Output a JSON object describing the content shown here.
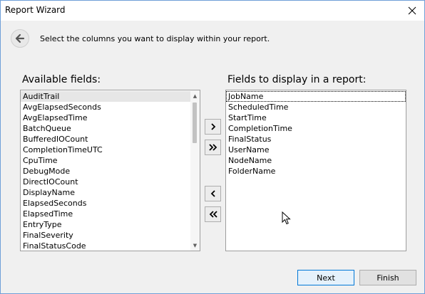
{
  "window": {
    "title": "Report Wizard",
    "close_icon": "close-icon"
  },
  "header": {
    "back_icon": "back-arrow-icon",
    "instruction": "Select the columns you want to display within your report."
  },
  "available": {
    "label": "Available fields:",
    "items": [
      "AuditTrail",
      "AvgElapsedSeconds",
      "AvgElapsedTime",
      "BatchQueue",
      "BufferedIOCount",
      "CompletionTimeUTC",
      "CpuTime",
      "DebugMode",
      "DirectIOCount",
      "DisplayName",
      "ElapsedSeconds",
      "ElapsedTime",
      "EntryType",
      "FinalSeverity",
      "FinalStatusCode"
    ],
    "highlighted": "AuditTrail",
    "scroll_position": 0.0
  },
  "display": {
    "label": "Fields to display in a report:",
    "items": [
      "JobName",
      "ScheduledTime",
      "StartTime",
      "CompletionTime",
      "FinalStatus",
      "UserName",
      "NodeName",
      "FolderName"
    ],
    "focused": "JobName"
  },
  "move_buttons": {
    "add_one": "chevron-right-icon",
    "add_all": "double-chevron-right-icon",
    "remove_one": "chevron-left-icon",
    "remove_all": "double-chevron-left-icon"
  },
  "footer": {
    "next_label": "Next",
    "finish_label": "Finish"
  },
  "colors": {
    "accent": "#0078d7",
    "panel": "#f0f0f0",
    "window_border": "#6f9fd8"
  }
}
